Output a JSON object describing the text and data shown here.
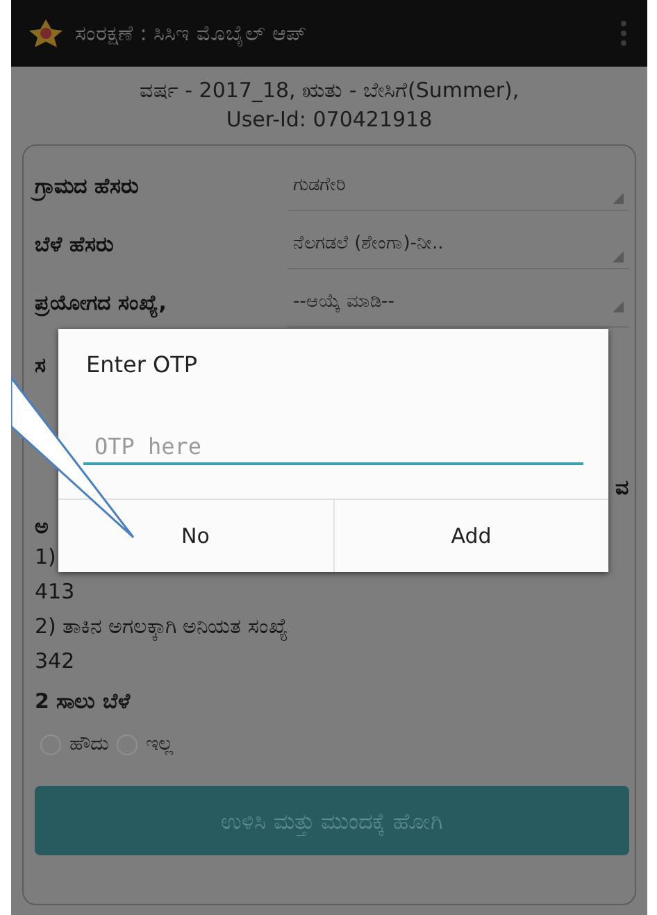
{
  "app_bar": {
    "title": "ಸಂರಕ್ಷಣೆ : ಸಿಸಿಇ ಮೊಬೈಲ್ ಆಪ್"
  },
  "header": {
    "line_1": "ವರ್ಷ - 2017_18, ಋತು - ಬೇಸಿಗೆ(Summer),",
    "line_2": "User-Id: 070421918"
  },
  "form": {
    "fields": [
      {
        "label": "ಗ್ರಾಮದ ಹೆಸರು",
        "value": "ಗುಡಗೇರಿ"
      },
      {
        "label": "ಬೆಳೆ ಹೆಸರು",
        "value": "ನೆಲಗಡಲೆ (ಶೇಂಗಾ)-ನೀ.."
      },
      {
        "label": "ಪ್ರಯೋಗದ ಸಂಖ್ಯೆ,",
        "value": "--ಆಯ್ಕೆ ಮಾಡಿ--"
      }
    ],
    "label_continuation": "ಸ",
    "covered_fragments": {
      "right": "ವ",
      "left": "ಅ",
      "item_1_number": "1)"
    },
    "item_1_value": "413",
    "item_2_label": "2) ತಾಕಿನ ಅಗಲಕ್ಕಾಗಿ ಅನಿಯತ ಸಂಖ್ಯೆ",
    "item_2_value": "342",
    "two_row_crop": {
      "label": "2 ಸಾಲು ಬೆಳೆ",
      "options": [
        {
          "label": "ಹೌದು",
          "selected": false
        },
        {
          "label": "ಇಲ್ಲ",
          "selected": false
        }
      ]
    },
    "submit_button": "ಉಳಿಸಿ ಮತ್ತು ಮುಂದಕ್ಕೆ ಹೋಗಿ"
  },
  "dialog": {
    "title": "Enter OTP",
    "placeholder": "OTP here",
    "buttons": [
      "No",
      "Add"
    ]
  }
}
